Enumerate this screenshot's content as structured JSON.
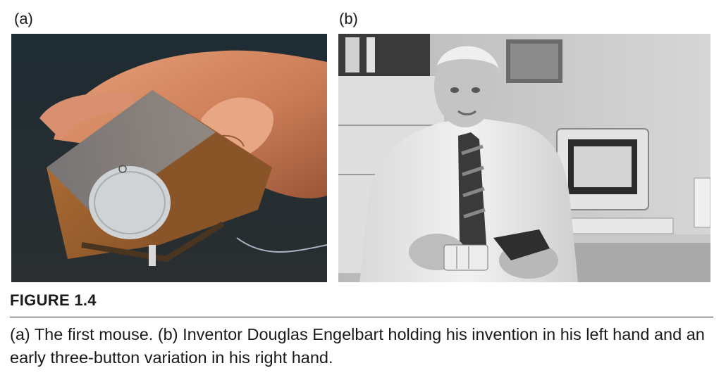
{
  "panels": {
    "a": {
      "label": "(a)"
    },
    "b": {
      "label": "(b)"
    }
  },
  "figure": {
    "title": "FIGURE 1.4",
    "caption": "(a) The first mouse. (b) Inventor Douglas Engelbart holding his invention in his left hand and an early three-button variation in his right hand."
  }
}
